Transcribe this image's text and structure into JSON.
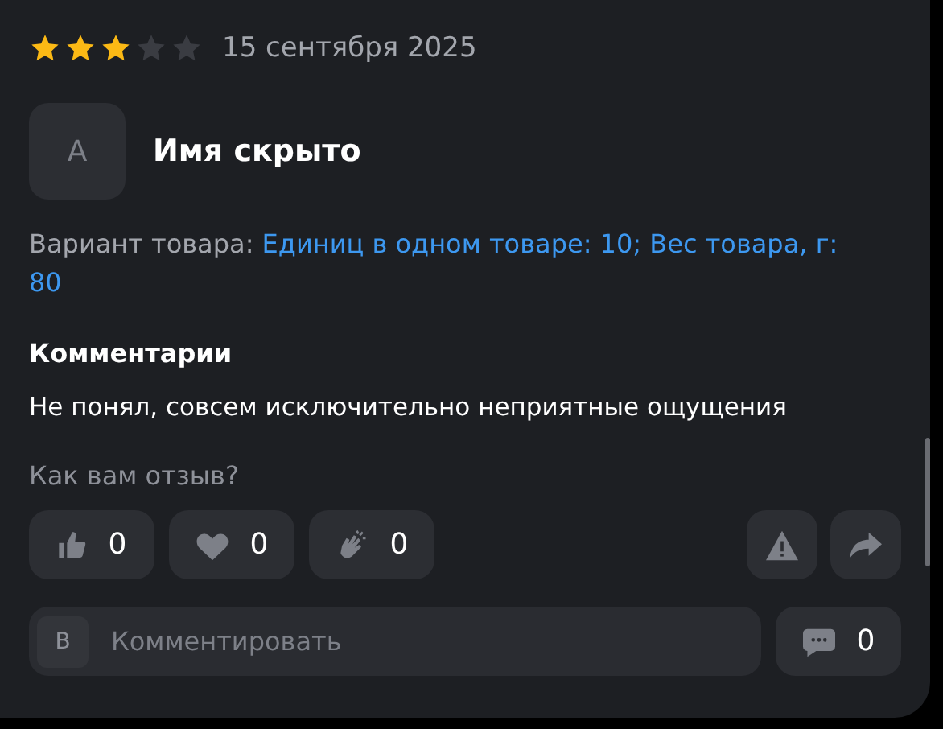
{
  "review": {
    "stars": 3,
    "date": "15 сентября 2025",
    "avatar_letter": "А",
    "author": "Имя скрыто",
    "variant_label": "Вариант товара:",
    "variant_value": "Единиц в одном товаре: 10; Вес товара, г: 80",
    "comment_heading": "Комментарии",
    "comment_text": "Не понял, совсем исключительно неприятные ощущения"
  },
  "feedback": {
    "question": "Как вам отзыв?",
    "reactions": [
      {
        "kind": "like",
        "count": "0"
      },
      {
        "kind": "heart",
        "count": "0"
      },
      {
        "kind": "clap",
        "count": "0"
      }
    ],
    "actions": [
      {
        "kind": "report"
      },
      {
        "kind": "share"
      }
    ]
  },
  "comment_box": {
    "avatar_letter": "В",
    "placeholder": "Комментировать",
    "comments_count": "0"
  }
}
